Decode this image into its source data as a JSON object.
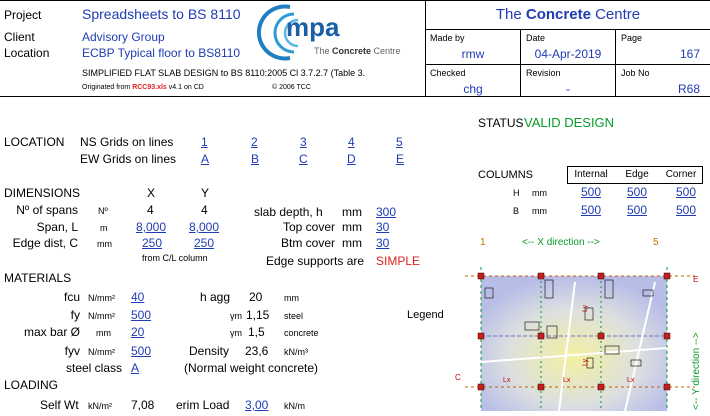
{
  "header": {
    "project_label": "Project",
    "project_value": "Spreadsheets to BS 8110",
    "client_label": "Client",
    "client_value": "Advisory Group",
    "location_label": "Location",
    "location_value": "ECBP Typical floor to BS8110",
    "subtitle": "SIMPLIFIED FLAT SLAB DESIGN to BS 8110:2005 Cl 3.7.2.7 (Table 3.",
    "originated_prefix": "Originated from ",
    "originated_file": "RCC93.xls",
    "originated_version": "v4.1 on CD",
    "copyright": "© 2006 TCC",
    "logo_text": "mpa",
    "logo_sub_pre": "The ",
    "logo_sub_bold": "Concrete",
    "logo_sub_post": " Centre",
    "org_pre": "The ",
    "org_bold": "Concrete",
    "org_post": " Centre",
    "made_by_label": "Made by",
    "made_by_value": "rmw",
    "date_label": "Date",
    "date_value": "04-Apr-2019",
    "page_label": "Page",
    "page_value": "167",
    "checked_label": "Checked",
    "checked_value": "chg",
    "revision_label": "Revision",
    "revision_value": "-",
    "job_label": "Job No",
    "job_value": "R68"
  },
  "location": {
    "label": "LOCATION",
    "ns_label": "NS Grids on lines",
    "ew_label": "EW Grids on lines",
    "ns_grids": [
      "1",
      "2",
      "3",
      "4",
      "5"
    ],
    "ew_grids": [
      "A",
      "B",
      "C",
      "D",
      "E"
    ]
  },
  "status": {
    "label": "STATUS",
    "value": "VALID DESIGN"
  },
  "dimensions": {
    "label": "DIMENSIONS",
    "x_head": "X",
    "y_head": "Y",
    "spans_label": "Nº of spans",
    "spans_unit": "Nº",
    "spans_x": "4",
    "spans_y": "4",
    "span_label": "Span, L",
    "span_unit": "m",
    "span_x": "8,000",
    "span_y": "8,000",
    "edge_label": "Edge dist, C",
    "edge_unit": "mm",
    "edge_x": "250",
    "edge_y": "250",
    "edge_note": "from C/L column",
    "slab_label": "slab depth, h",
    "slab_unit": "mm",
    "slab_value": "300",
    "top_label": "Top cover",
    "top_unit": "mm",
    "top_value": "30",
    "btm_label": "Btm cover",
    "btm_unit": "mm",
    "btm_value": "30",
    "supports_label": "Edge supports are",
    "supports_value": "SIMPLE"
  },
  "columns": {
    "label": "COLUMNS",
    "headers": [
      "Internal",
      "Edge",
      "Corner"
    ],
    "h_label": "H",
    "b_label": "B",
    "unit": "mm",
    "h_values": [
      "500",
      "500",
      "500"
    ],
    "b_values": [
      "500",
      "500",
      "500"
    ]
  },
  "direction": {
    "left": "1",
    "text": "<-- X direction -->",
    "right": "5",
    "y_text": "<-- Y direction -->"
  },
  "materials": {
    "label": "MATERIALS",
    "fcu_label": "fcu",
    "fcu_unit": "N/mm²",
    "fcu_value": "40",
    "fy_label": "fy",
    "fy_unit": "N/mm²",
    "fy_value": "500",
    "maxbar_label": "max bar Ø",
    "maxbar_unit": "mm",
    "maxbar_value": "20",
    "fyv_label": "fyv",
    "fyv_unit": "N/mm²",
    "fyv_value": "500",
    "steel_label": "steel class",
    "steel_value": "A",
    "hagg_label": "h agg",
    "hagg_value": "20",
    "hagg_unit": "mm",
    "gm_steel_label": "γm",
    "gm_steel_value": "1,15",
    "gm_steel_unit": "steel",
    "gm_conc_label": "γm",
    "gm_conc_value": "1,5",
    "gm_conc_unit": "concrete",
    "density_label": "Density",
    "density_value": "23,6",
    "density_unit": "kN/m³",
    "weight_note": "(Normal weight concrete)",
    "legend_label": "Legend"
  },
  "loading": {
    "label": "LOADING",
    "selfwt_label": "Self Wt",
    "selfwt_unit": "kN/m²",
    "selfwt_value": "7,08",
    "partition_label": "erim Load",
    "partition_value": "3,00",
    "partition_unit": "kN/m"
  },
  "diagram": {
    "edge_letter_e": "E",
    "edge_letter_c": "C",
    "lx_label": "Lx",
    "ly_label": "Ly"
  }
}
